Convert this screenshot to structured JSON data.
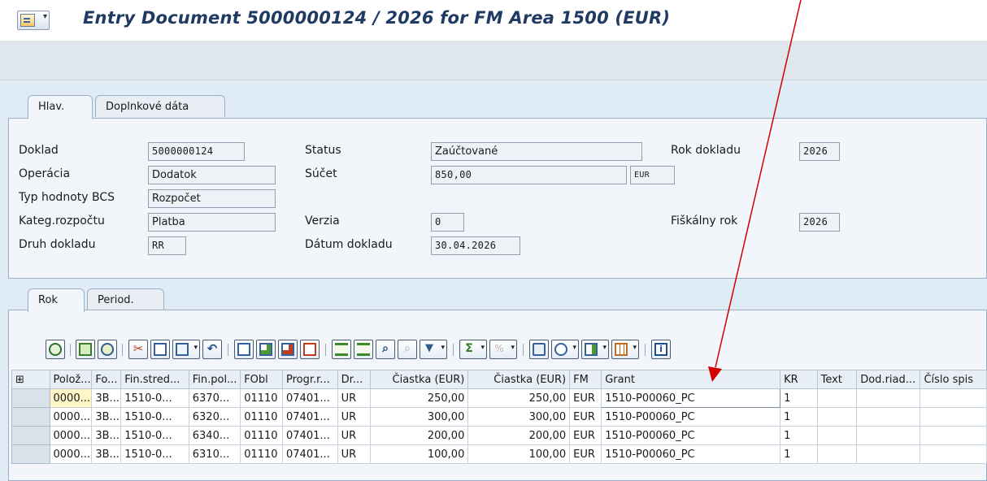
{
  "window": {
    "title": "Entry Document 5000000124 / 2026 for FM Area 1500 (EUR)"
  },
  "header_tabs": [
    {
      "label": "Hlav.",
      "active": true
    },
    {
      "label": "Doplnkové dáta",
      "active": false
    }
  ],
  "header": {
    "doklad": {
      "label": "Doklad",
      "value": "5000000124"
    },
    "operacia": {
      "label": "Operácia",
      "value": "Dodatok"
    },
    "typ_hodnoty": {
      "label": "Typ hodnoty BCS",
      "value": "Rozpočet"
    },
    "kategoria": {
      "label": "Kateg.rozpočtu",
      "value": "Platba"
    },
    "druh_dokladu": {
      "label": "Druh dokladu",
      "value": "RR"
    },
    "status": {
      "label": "Status",
      "value": "Zaúčtované"
    },
    "sucet": {
      "label": "Súčet",
      "value": "850,00",
      "currency": "EUR"
    },
    "verzia": {
      "label": "Verzia",
      "value": "0"
    },
    "datum_dokladu": {
      "label": "Dátum dokladu",
      "value": "30.04.2026"
    },
    "rok_dokladu": {
      "label": "Rok dokladu",
      "value": "2026"
    },
    "fiskalny_rok": {
      "label": "Fiškálny rok",
      "value": "2026"
    }
  },
  "item_tabs": [
    {
      "label": "Rok",
      "active": true
    },
    {
      "label": "Period.",
      "active": false
    }
  ],
  "toolbar_icons": [
    "details-icon",
    "select-all-icon",
    "refresh-icon",
    "cut-icon",
    "copy-icon",
    "paste-icon",
    "undo-icon",
    "new-row-icon",
    "insert-row-icon",
    "delete-row-icon",
    "copy-row-icon",
    "sort-ascending-icon",
    "sort-descending-icon",
    "find-icon",
    "find-next-icon",
    "filter-icon",
    "sum-icon",
    "subtotal-icon",
    "print-icon",
    "views-icon",
    "export-icon",
    "layout-icon",
    "info-icon"
  ],
  "table": {
    "columns": [
      "Polož...",
      "Fo...",
      "Fin.stred...",
      "Fin.pol...",
      "FObl",
      "Progr.r...",
      "Dr...",
      "Čiastka (EUR)",
      "Čiastka (EUR)",
      "FM",
      "Grant",
      "KR",
      "Text",
      "Dod.riad...",
      "Číslo spis"
    ],
    "rows": [
      [
        "0000...",
        "3B...",
        "1510-0...",
        "6370...",
        "01110",
        "07401...",
        "UR",
        "250,00",
        "250,00",
        "EUR",
        "1510-P00060_PC",
        "1",
        "",
        "",
        ""
      ],
      [
        "0000...",
        "3B...",
        "1510-0...",
        "6320...",
        "01110",
        "07401...",
        "UR",
        "300,00",
        "300,00",
        "EUR",
        "1510-P00060_PC",
        "1",
        "",
        "",
        ""
      ],
      [
        "0000...",
        "3B...",
        "1510-0...",
        "6340...",
        "01110",
        "07401...",
        "UR",
        "200,00",
        "200,00",
        "EUR",
        "1510-P00060_PC",
        "1",
        "",
        "",
        ""
      ],
      [
        "0000...",
        "3B...",
        "1510-0...",
        "6310...",
        "01110",
        "07401...",
        "UR",
        "100,00",
        "100,00",
        "EUR",
        "1510-P00060_PC",
        "1",
        "",
        "",
        ""
      ]
    ]
  },
  "colors": {
    "title": "#1f3a63",
    "annotation_arrow": "#d40000"
  }
}
